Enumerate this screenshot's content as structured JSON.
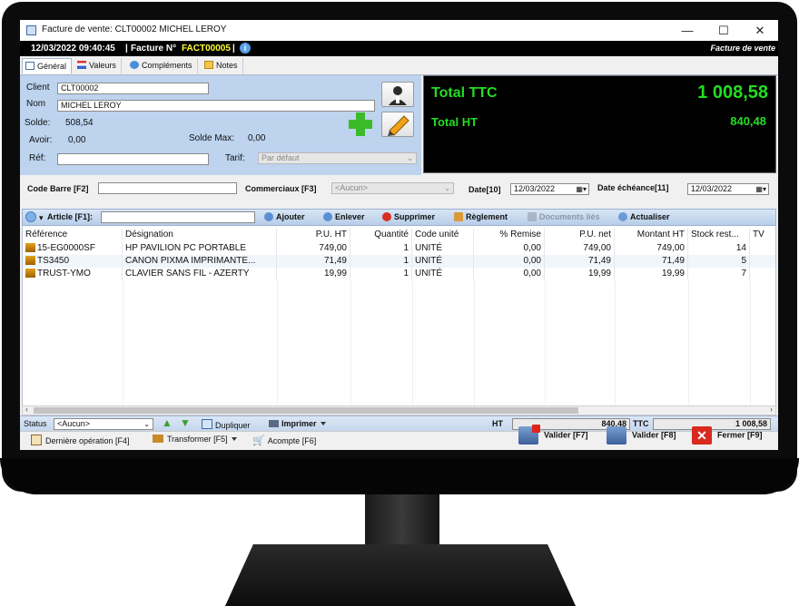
{
  "window": {
    "title": "Facture de vente: CLT00002 MICHEL LEROY",
    "minimize": "—",
    "maximize": "☐",
    "close": "✕"
  },
  "infobar": {
    "datetime": "12/03/2022 09:40:45",
    "facture_label": "Facture N°",
    "facture_number": "FACT00005",
    "doc_type": "Facture de vente"
  },
  "tabs": [
    "Général",
    "Valeurs",
    "Compléments",
    "Notes"
  ],
  "client": {
    "client_label": "Client",
    "client_value": "CLT00002",
    "nom_label": "Nom",
    "nom_value": "MICHEL LEROY",
    "solde_label": "Solde:",
    "solde_value": "508,54",
    "avoir_label": "Avoir:",
    "avoir_value": "0,00",
    "soldemax_label": "Solde Max:",
    "soldemax_value": "0,00",
    "ref_label": "Réf:",
    "ref_value": "",
    "tarif_label": "Tarif:",
    "tarif_value": "Par défaut"
  },
  "totals": {
    "ttc_label": "Total TTC",
    "ttc_value": "1 008,58",
    "ht_label": "Total HT",
    "ht_value": "840,48"
  },
  "codebar": {
    "code_label": "Code Barre [F2]",
    "code_value": "",
    "commerciaux_label": "Commerciaux [F3]",
    "commerciaux_value": "<Aucun>",
    "date_label": "Date[10]",
    "date_value": "12/03/2022",
    "echeance_label": "Date échéance[11]",
    "echeance_value": "12/03/2022"
  },
  "article_bar": {
    "article_label": "Article [F1]:",
    "article_value": "",
    "ajouter": "Ajouter",
    "enlever": "Enlever",
    "supprimer": "Supprimer",
    "reglement": "Règlement",
    "documents_lies": "Documents liés",
    "actualiser": "Actualiser"
  },
  "grid": {
    "columns": [
      "Référence",
      "Désignation",
      "P.U. HT",
      "Quantité",
      "Code unité",
      "% Remise",
      "P.U. net",
      "Montant HT",
      "Stock rest...",
      "TV"
    ],
    "rows": [
      [
        "15-EG0000SF",
        "HP PAVILION  PC PORTABLE",
        "749,00",
        "1",
        "UNITÉ",
        "0,00",
        "749,00",
        "749,00",
        "14",
        ""
      ],
      [
        "TS3450",
        "CANON PIXMA IMPRIMANTE...",
        "71,49",
        "1",
        "UNITÉ",
        "0,00",
        "71,49",
        "71,49",
        "5",
        ""
      ],
      [
        "TRUST-YMO",
        "CLAVIER SANS FIL - AZERTY",
        "19,99",
        "1",
        "UNITÉ",
        "0,00",
        "19,99",
        "19,99",
        "7",
        ""
      ]
    ]
  },
  "statusbar": {
    "status_label": "Status",
    "status_value": "<Aucun>",
    "dupliquer": "Dupliquer",
    "imprimer": "Imprimer",
    "ht_label": "HT",
    "ht_value": "840,48",
    "ttc_label": "TTC",
    "ttc_value": "1 008,58"
  },
  "bottombar": {
    "derniere": "Dernière opération [F4]",
    "transformer": "Transformer [F5]",
    "acompte": "Acompte [F6]",
    "valider7": "Valider [F7]",
    "valider8": "Valider [F8]",
    "fermer": "Fermer [F9]"
  },
  "colors": {
    "accent_green": "#22dd22",
    "facture_yellow": "#ffff33",
    "panel_blue": "#bdd3ee"
  }
}
